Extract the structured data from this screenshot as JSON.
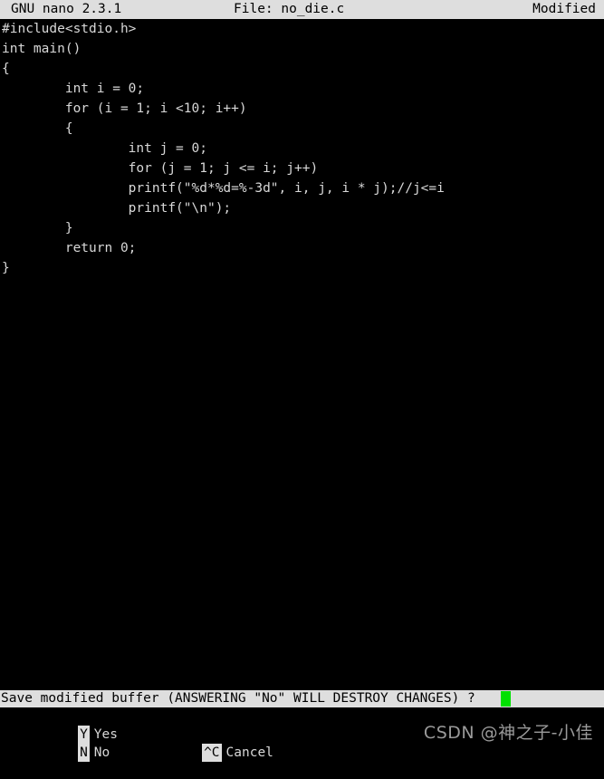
{
  "titlebar": {
    "version": "GNU nano 2.3.1",
    "file": "File: no_die.c",
    "flag": "Modified"
  },
  "editor": {
    "lines": [
      "#include<stdio.h>",
      "int main()",
      "{",
      "        int i = 0;",
      "        for (i = 1; i <10; i++)",
      "        {",
      "                int j = 0;",
      "                for (j = 1; j <= i; j++)",
      "                printf(\"%d*%d=%-3d\", i, j, i * j);//j<=i",
      "                printf(\"\\n\");",
      "        }",
      "        return 0;",
      "}"
    ]
  },
  "prompt": {
    "text": "Save modified buffer (ANSWERING \"No\" WILL DESTROY CHANGES) ?",
    "cursor_color": "#00e000"
  },
  "shortcuts": {
    "row1": [
      {
        "key": "Y",
        "label": "Yes"
      }
    ],
    "row2": [
      {
        "key": "N",
        "label": "No"
      },
      {
        "key": "^C",
        "label": "Cancel"
      }
    ]
  },
  "watermark": {
    "text": "CSDN @神之子-小佳"
  },
  "colors": {
    "bar_background": "#dedede",
    "bar_foreground": "#000000",
    "terminal_background": "#000000",
    "terminal_foreground": "#d8d8d8",
    "cursor": "#00e000",
    "watermark": "#9a9a9a"
  }
}
